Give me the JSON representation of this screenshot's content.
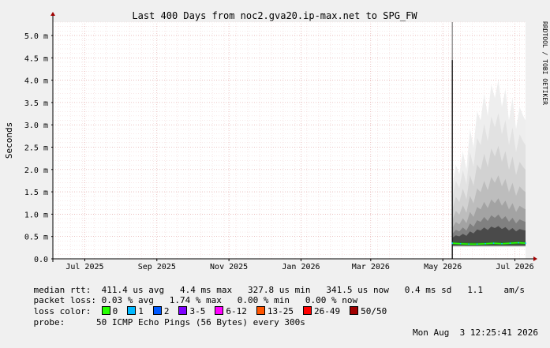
{
  "chart_data": {
    "type": "line",
    "title": "Last 400 Days from noc2.gva20.ip-max.net to SPG_FW",
    "ylabel": "Seconds",
    "watermark": "RRDTOOL / TOBI OETIKER",
    "ylim": [
      0,
      5.3
    ],
    "y_ticks": [
      {
        "value": 0.0,
        "label": "0.0"
      },
      {
        "value": 0.5,
        "label": "0.5 m"
      },
      {
        "value": 1.0,
        "label": "1.0 m"
      },
      {
        "value": 1.5,
        "label": "1.5 m"
      },
      {
        "value": 2.0,
        "label": "2.0 m"
      },
      {
        "value": 2.5,
        "label": "2.5 m"
      },
      {
        "value": 3.0,
        "label": "3.0 m"
      },
      {
        "value": 3.5,
        "label": "3.5 m"
      },
      {
        "value": 4.0,
        "label": "4.0 m"
      },
      {
        "value": 4.5,
        "label": "4.5 m"
      },
      {
        "value": 5.0,
        "label": "5.0 m"
      }
    ],
    "x_range_days": [
      0,
      400
    ],
    "x_ticks": [
      {
        "day": 27,
        "label": "Jul 2025"
      },
      {
        "day": 88,
        "label": "Sep 2025"
      },
      {
        "day": 149,
        "label": "Nov 2025"
      },
      {
        "day": 210,
        "label": "Jan 2026"
      },
      {
        "day": 269,
        "label": "Mar 2026"
      },
      {
        "day": 330,
        "label": "May 2026"
      },
      {
        "day": 391,
        "label": "Jul 2026"
      }
    ],
    "data_start_day": 338,
    "spike": {
      "day": 338,
      "value": 4.45
    },
    "smoke_upper": [
      [
        338,
        1.6
      ],
      [
        341,
        2.1
      ],
      [
        344,
        1.9
      ],
      [
        347,
        2.4
      ],
      [
        350,
        2.0
      ],
      [
        353,
        2.9
      ],
      [
        356,
        2.5
      ],
      [
        359,
        3.3
      ],
      [
        362,
        3.1
      ],
      [
        365,
        3.7
      ],
      [
        368,
        3.2
      ],
      [
        371,
        3.9
      ],
      [
        374,
        3.6
      ],
      [
        377,
        4.0
      ],
      [
        380,
        3.4
      ],
      [
        383,
        3.8
      ],
      [
        386,
        3.1
      ],
      [
        389,
        3.6
      ],
      [
        392,
        2.9
      ],
      [
        395,
        3.4
      ],
      [
        398,
        3.2
      ],
      [
        400,
        3.1
      ]
    ],
    "median_rtt": [
      [
        338,
        0.35
      ],
      [
        345,
        0.34
      ],
      [
        352,
        0.33
      ],
      [
        359,
        0.33
      ],
      [
        366,
        0.34
      ],
      [
        373,
        0.35
      ],
      [
        380,
        0.34
      ],
      [
        387,
        0.35
      ],
      [
        394,
        0.36
      ],
      [
        400,
        0.35
      ]
    ]
  },
  "stats": {
    "median_rtt": {
      "label": "median rtt:",
      "values": "411.4 us avg   4.4 ms max   327.8 us min   341.5 us now   0.4 ms sd   1.1    am/s"
    },
    "packet_loss": {
      "label": "packet loss:",
      "values": "0.03 % avg   1.74 % max   0.00 % min   0.00 % now"
    },
    "loss_color": {
      "label": "loss color:",
      "items": [
        {
          "label": "0",
          "color": "#26ff00"
        },
        {
          "label": "1",
          "color": "#00b8ff"
        },
        {
          "label": "2",
          "color": "#0059ff"
        },
        {
          "label": "3-5",
          "color": "#7e00ff"
        },
        {
          "label": "6-12",
          "color": "#ff00ff"
        },
        {
          "label": "13-25",
          "color": "#ff5500"
        },
        {
          "label": "26-49",
          "color": "#ff0000"
        },
        {
          "label": "50/50",
          "color": "#a10000"
        }
      ]
    },
    "probe": {
      "label": "probe:",
      "description": "50 ICMP Echo Pings (56 Bytes) every 300s"
    },
    "timestamp": "Mon Aug  3 12:25:41 2026"
  }
}
